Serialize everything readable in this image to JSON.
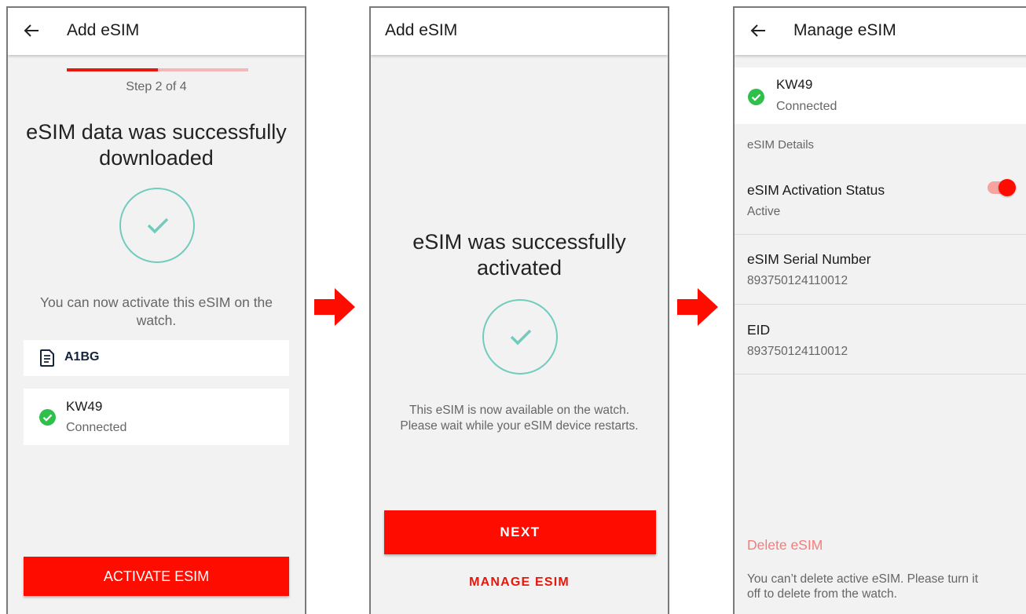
{
  "screen1": {
    "title": "Add eSIM",
    "progress_fraction": 0.5,
    "step_text": "Step 2 of 4",
    "headline_line1": "eSIM data was successfully",
    "headline_line2": "downloaded",
    "body_line1": "You can now activate this eSIM on the",
    "body_line2": "watch.",
    "sim_card_label": "A1BG",
    "network_name": "KW49",
    "network_status": "Connected",
    "activate_button": "ACTIVATE ESIM"
  },
  "screen2": {
    "title": "Add eSIM",
    "headline_line1": "eSIM was successfully",
    "headline_line2": "activated",
    "body_line1": "This eSIM is now available on the watch.",
    "body_line2": "Please wait while your eSIM device restarts.",
    "next_button": "NEXT",
    "manage_link": "MANAGE ESIM"
  },
  "screen3": {
    "title": "Manage eSIM",
    "network_name": "KW49",
    "network_status": "Connected",
    "section_header": "eSIM Details",
    "activation_label": "eSIM Activation Status",
    "activation_value": "Active",
    "activation_enabled": true,
    "serial_label": "eSIM Serial Number",
    "serial_value": "893750124110012",
    "eid_label": "EID",
    "eid_value": "893750124110012",
    "delete_label": "Delete eSIM",
    "delete_note_line1": "You can’t delete active eSIM. Please turn it",
    "delete_note_line2": "off to delete from the watch."
  },
  "icons": {
    "back": "arrow-left-icon",
    "check": "checkmark-icon",
    "connected": "check-circle-icon",
    "sim": "sim-card-icon",
    "flow_arrow": "arrow-right-icon"
  },
  "colors": {
    "accent_red": "#ff0c00",
    "progress_track": "#f5b8b8",
    "success_green": "#2ec04a",
    "check_teal": "#72ccbd",
    "delete_pink": "#f47c7c",
    "background": "#f2f2f2"
  }
}
